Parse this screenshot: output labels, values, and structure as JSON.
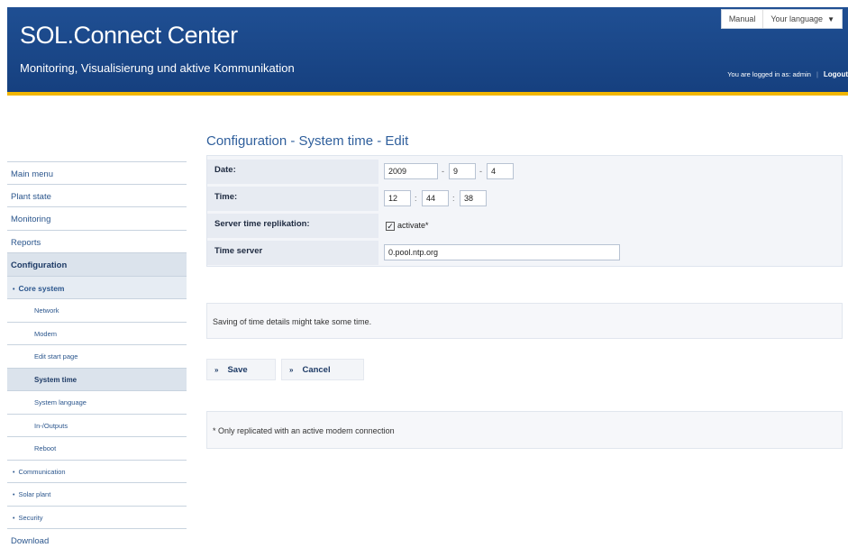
{
  "header": {
    "title": "SOL.Connect Center",
    "subtitle": "Monitoring, Visualisierung und aktive Kommunikation",
    "manual_link": "Manual",
    "language_label": "Your language",
    "logged_in": "You are logged in as: admin",
    "logout": "Logout",
    "accent_color": "#f2b600",
    "header_color": "#1f4f93"
  },
  "sidebar": {
    "main_menu": "Main menu",
    "plant_state": "Plant state",
    "monitoring": "Monitoring",
    "reports": "Reports",
    "configuration": "Configuration",
    "core_system": "Core system",
    "network": "Network",
    "modem": "Modem",
    "edit_start_page": "Edit start page",
    "system_time": "System time",
    "system_language": "System language",
    "inputs_outputs": "In-/Outputs",
    "reboot": "Reboot",
    "communication": "Communication",
    "solar_plant": "Solar plant",
    "security": "Security",
    "download": "Download"
  },
  "main": {
    "page_title": "Configuration - System time - Edit",
    "date_label": "Date:",
    "date_year": "2009",
    "date_month": "9",
    "date_day": "4",
    "time_label": "Time:",
    "time_hour": "12",
    "time_minute": "44",
    "time_second": "38",
    "replication_label": "Server time replikation:",
    "replication_checkbox": "activate*",
    "replication_checked": true,
    "time_server_label": "Time server",
    "time_server_value": "0.pool.ntp.org",
    "note": "Saving of time details might take some time.",
    "save_button": "Save",
    "cancel_button": "Cancel",
    "hint": "* Only replicated with an active modem connection"
  }
}
